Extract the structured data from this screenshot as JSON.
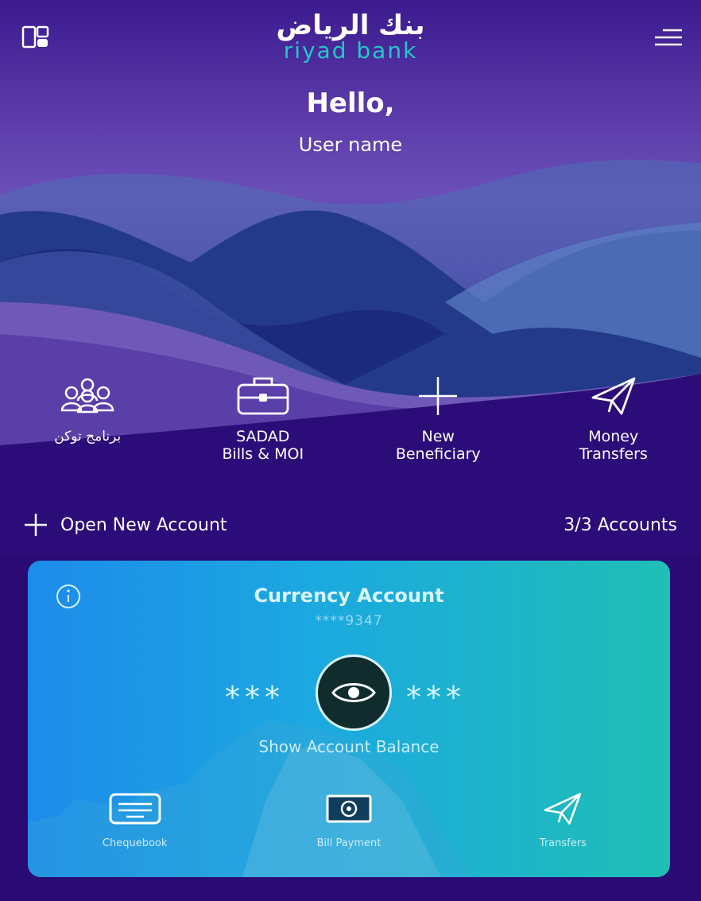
{
  "app": {
    "logo_arabic": "بنك الرياض",
    "logo_english": "riyad bank"
  },
  "header": {
    "greeting": "Hello,",
    "user_name": "User name"
  },
  "quick_actions": [
    {
      "icon": "group-people-icon",
      "label": "برنامج توكن"
    },
    {
      "icon": "briefcase-icon",
      "label": "SADAD\nBills & MOI"
    },
    {
      "icon": "plus-icon",
      "label": "New\nBeneficiary"
    },
    {
      "icon": "paper-plane-icon",
      "label": "Money\nTransfers"
    }
  ],
  "accounts": {
    "open_new_label": "Open New Account",
    "count_label": "3/3 Accounts"
  },
  "card": {
    "title": "Currency Account",
    "number_masked": "****9347",
    "balance_mask_left": "***",
    "balance_mask_right": "***",
    "show_balance_label": "Show Account Balance",
    "actions": [
      {
        "icon": "chequebook-icon",
        "label": "Chequebook"
      },
      {
        "icon": "bill-payment-icon",
        "label": "Bill Payment"
      },
      {
        "icon": "paper-plane-icon",
        "label": "Transfers"
      }
    ]
  },
  "colors": {
    "background": "#2a0b74",
    "accent_teal": "#24c7c7",
    "card_start": "#1d8bea",
    "card_end": "#1fbfb5"
  }
}
